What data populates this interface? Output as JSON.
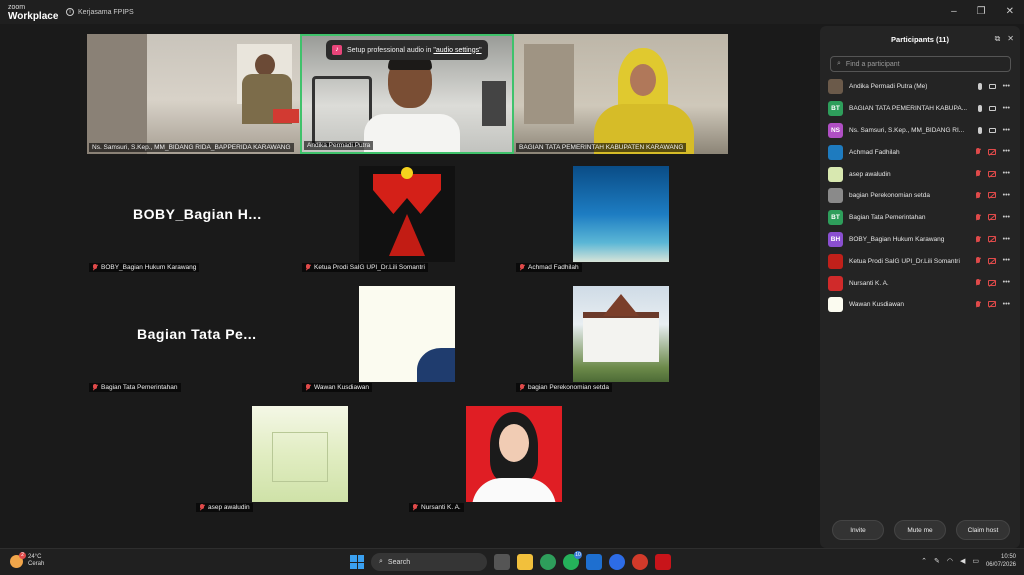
{
  "titlebar": {
    "brand_small": "zoom",
    "brand_large": "Workplace",
    "meeting_name": "Kerjasama FPIPS",
    "controls": [
      "–",
      "❐",
      "✕"
    ]
  },
  "stage": {
    "tooltip": {
      "prefix": "Setup professional audio in ",
      "link": "\"audio settings\""
    },
    "tiles": [
      {
        "label": "Ns. Samsuri, S.Kep., MM_BIDANG RIDA_BAPPERIDA KARAWANG",
        "muted": false
      },
      {
        "label": "Andika Permadi Putra",
        "muted": false
      },
      {
        "label": "BAGIAN TATA PEMERINTAH KABUPATEN KARAWANG",
        "muted": false
      },
      {
        "label": "BOBY_Bagian Hukum Karawang",
        "muted": true,
        "big_name": "BOBY_Bagian  H..."
      },
      {
        "label": "Ketua Prodi SaIG UPI_Dr.Lili Somantri",
        "muted": true
      },
      {
        "label": "Achmad Fadhilah",
        "muted": true
      },
      {
        "label": "Bagian Tata Pemerintahan",
        "muted": true,
        "big_name": "Bagian  Tata  Pe..."
      },
      {
        "label": "Wawan Kusdiawan",
        "muted": true
      },
      {
        "label": "bagian Perekonomian setda",
        "muted": true
      },
      {
        "label": "asep awaludin",
        "muted": true
      },
      {
        "label": "Nursanti K. A.",
        "muted": true
      }
    ]
  },
  "participants": {
    "title": "Participants (11)",
    "search_placeholder": "Find a participant",
    "list": [
      {
        "name": "Andika Permadi Putra (Me)",
        "initials": "",
        "avatar_color": "#6b5a4a",
        "mic": "on",
        "cam": "on"
      },
      {
        "name": "BAGIAN TATA PEMERINTAH KABUPA...",
        "initials": "BT",
        "avatar_color": "#2e9e5b",
        "mic": "on",
        "cam": "on"
      },
      {
        "name": "Ns. Samsuri, S.Kep., MM_BIDANG RI...",
        "initials": "NS",
        "avatar_color": "#b04fc4",
        "mic": "on",
        "cam": "on"
      },
      {
        "name": "Achmad Fadhilah",
        "initials": "",
        "avatar_color": "#1e7bbf",
        "mic": "off",
        "cam": "off"
      },
      {
        "name": "asep awaludin",
        "initials": "",
        "avatar_color": "#d8e8b0",
        "mic": "off",
        "cam": "off"
      },
      {
        "name": "bagian Perekonomian setda",
        "initials": "",
        "avatar_color": "#8a8a8a",
        "mic": "off",
        "cam": "off"
      },
      {
        "name": "Bagian Tata Pemerintahan",
        "initials": "BT",
        "avatar_color": "#2e9e5b",
        "mic": "off",
        "cam": "off"
      },
      {
        "name": "BOBY_Bagian Hukum Karawang",
        "initials": "BH",
        "avatar_color": "#8a4fd0",
        "mic": "off",
        "cam": "off"
      },
      {
        "name": "Ketua Prodi SaIG UPI_Dr.Lili Somantri",
        "initials": "",
        "avatar_color": "#c0201a",
        "mic": "off",
        "cam": "off"
      },
      {
        "name": "Nursanti K. A.",
        "initials": "",
        "avatar_color": "#d02a2a",
        "mic": "off",
        "cam": "off"
      },
      {
        "name": "Wawan Kusdiawan",
        "initials": "",
        "avatar_color": "#fbfbf0",
        "mic": "off",
        "cam": "off"
      }
    ],
    "buttons": {
      "invite": "Invite",
      "mute_me": "Mute me",
      "claim_host": "Claim host"
    }
  },
  "taskbar": {
    "weather_temp": "24°C",
    "weather_cond": "Cerah",
    "weather_badge": "2",
    "search_label": "Search",
    "whatsapp_badge": "10",
    "time": "10:50",
    "date": "06/07/2026"
  }
}
